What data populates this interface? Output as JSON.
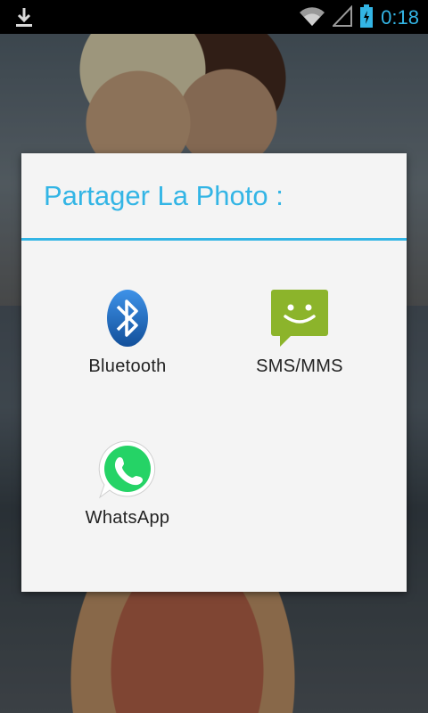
{
  "status": {
    "time": "0:18",
    "icons": [
      "download-icon",
      "wifi-icon",
      "signal-icon",
      "battery-charging-icon"
    ]
  },
  "dialog": {
    "title": "Partager La Photo :",
    "apps": [
      {
        "label": "Bluetooth",
        "icon": "bluetooth-icon"
      },
      {
        "label": "SMS/MMS",
        "icon": "sms-icon"
      },
      {
        "label": "WhatsApp",
        "icon": "whatsapp-icon"
      }
    ]
  },
  "colors": {
    "accent": "#33b5e5",
    "dialog_bg": "#f4f4f4",
    "sms_green": "#8cb42b",
    "whatsapp_green": "#25d366",
    "bluetooth_blue": "#1f6fc6"
  }
}
